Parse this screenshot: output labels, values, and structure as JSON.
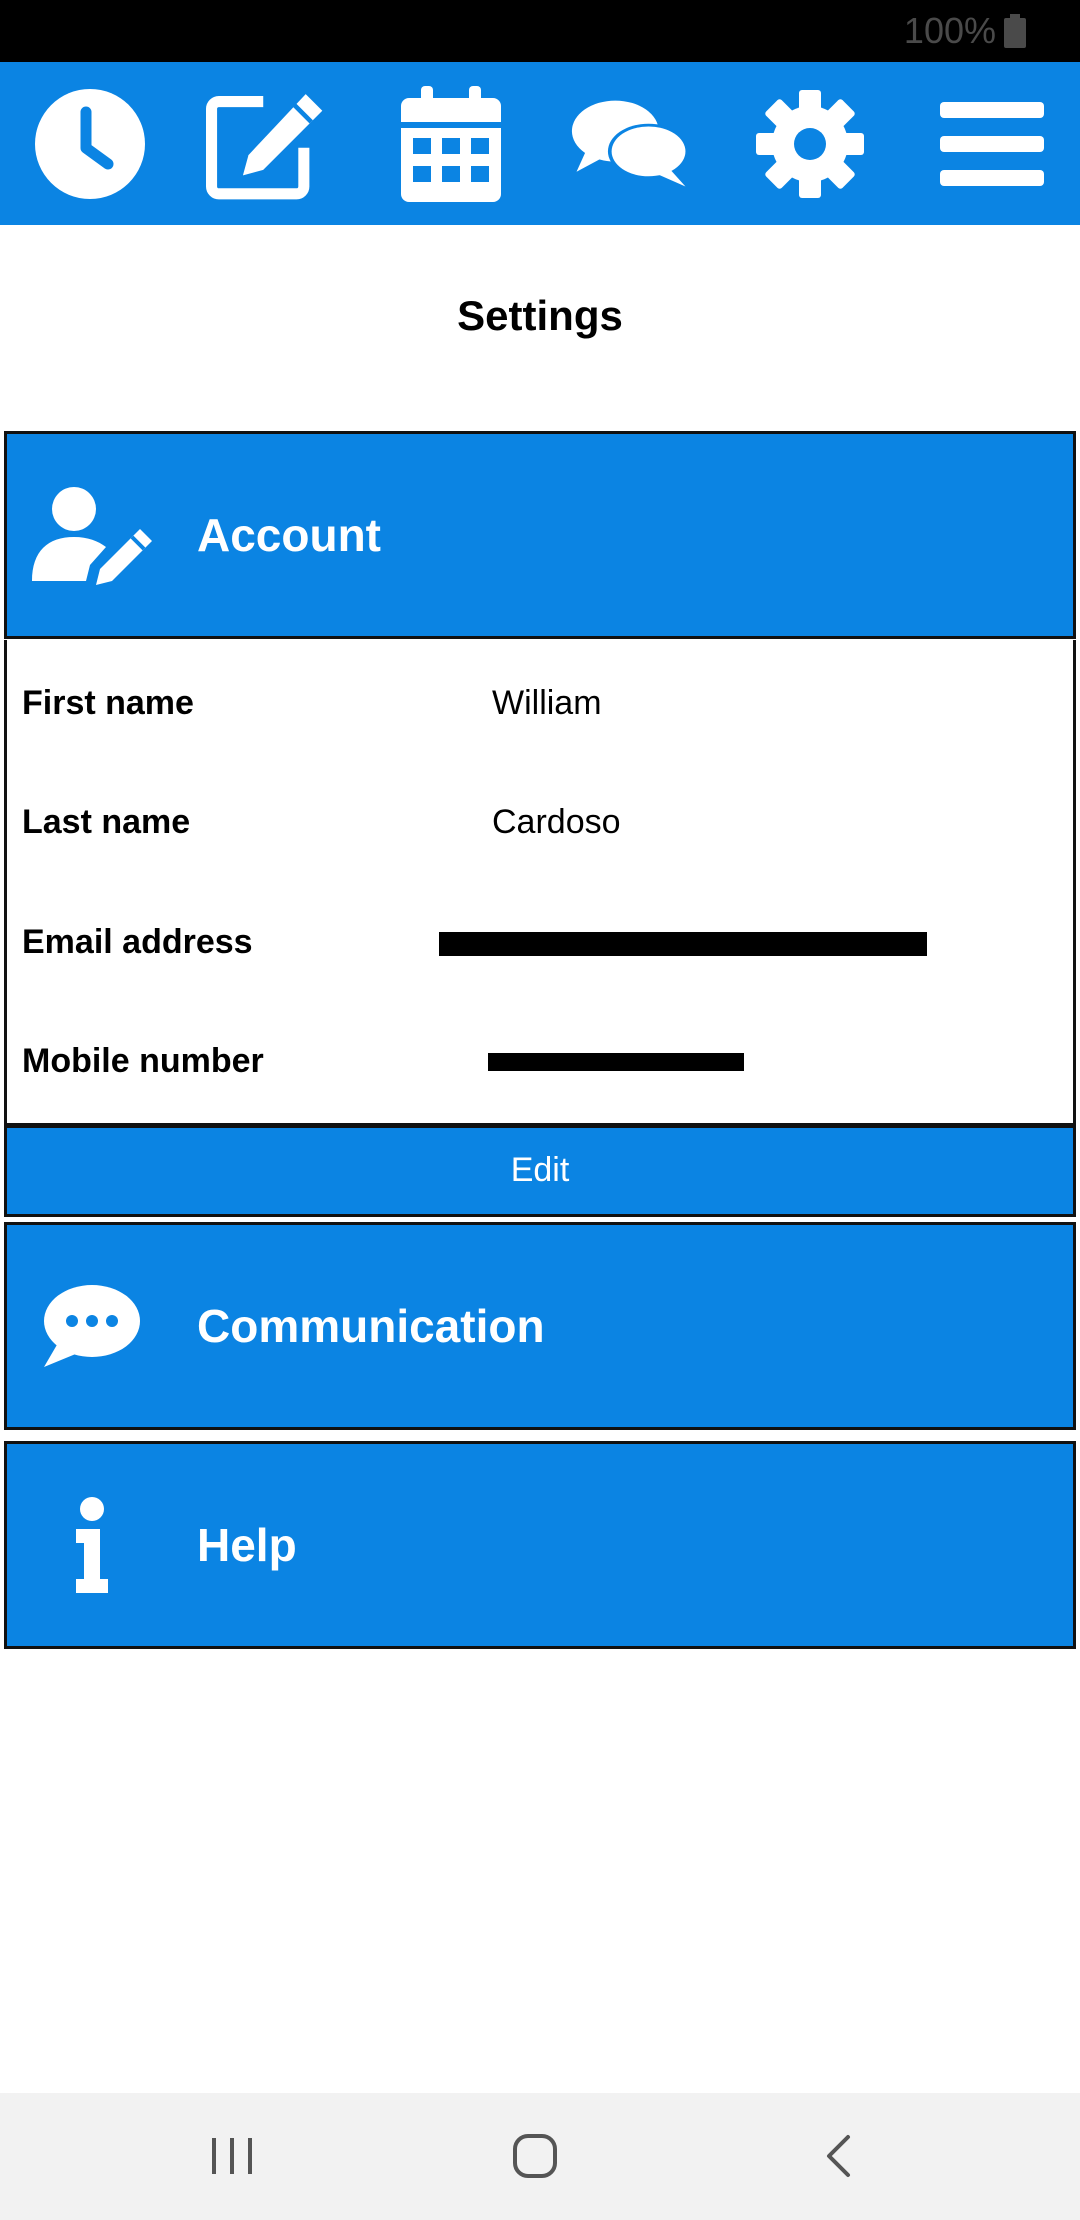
{
  "status_bar": {
    "battery_text": "100%",
    "battery_icon": "battery-full-icon"
  },
  "toolbar": {
    "items": [
      {
        "icon": "clock-icon"
      },
      {
        "icon": "edit-icon"
      },
      {
        "icon": "calendar-icon"
      },
      {
        "icon": "chat-icon"
      },
      {
        "icon": "gear-icon"
      },
      {
        "icon": "hamburger-menu-icon"
      }
    ]
  },
  "page": {
    "title": "Settings"
  },
  "sections": {
    "account": {
      "label": "Account",
      "icon": "user-edit-icon",
      "fields": [
        {
          "label": "First name",
          "value": "William"
        },
        {
          "label": "Last name",
          "value": "Cardoso"
        },
        {
          "label": "Email address",
          "value": ""
        },
        {
          "label": "Mobile number",
          "value": ""
        }
      ],
      "edit_label": "Edit"
    },
    "communication": {
      "label": "Communication",
      "icon": "speech-bubble-icon"
    },
    "help": {
      "label": "Help",
      "icon": "info-icon"
    }
  },
  "nav_bar": {
    "items": [
      {
        "icon": "recent-apps-icon"
      },
      {
        "icon": "home-icon"
      },
      {
        "icon": "back-icon"
      }
    ]
  },
  "colors": {
    "accent": "#0b84e3",
    "border": "#111111",
    "status_bar": "#000000",
    "nav_bar": "#f2f2f2"
  }
}
